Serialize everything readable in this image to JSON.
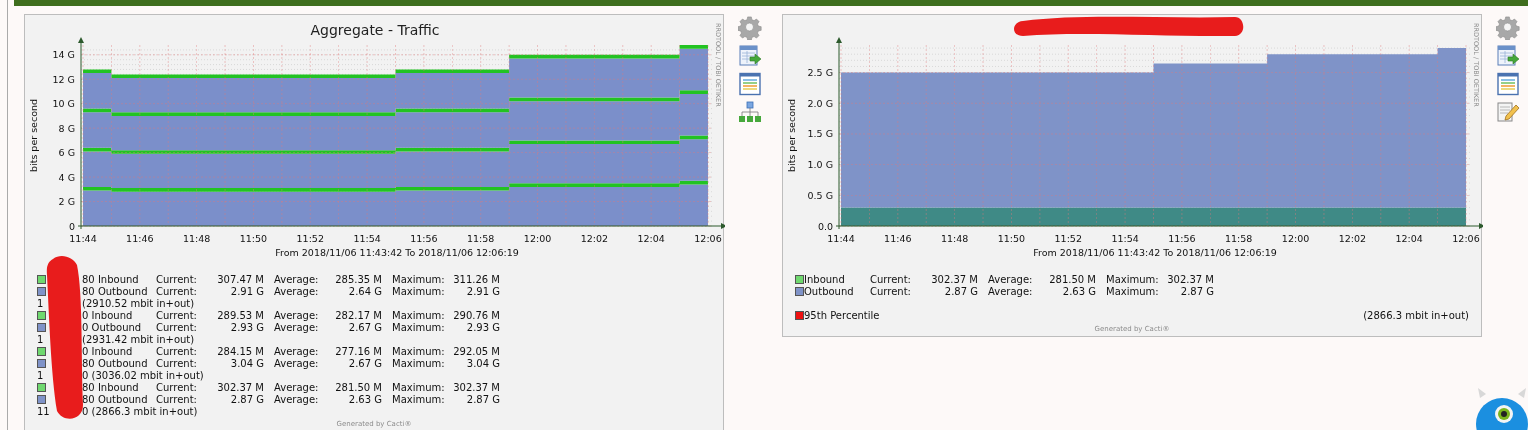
{
  "panels": [
    {
      "title": "Aggregate - Traffic",
      "title_redacted": false,
      "side_label": "RRDTOOL / TOBI OETIKER",
      "legend_redacted": true,
      "chart_data": {
        "type": "area",
        "stacked": true,
        "ylabel": "bits per second",
        "xlabel": "From 2018/11/06 11:43:42 To 2018/11/06 12:06:19",
        "grid": true,
        "categories": [
          "11:44",
          "11:46",
          "11:48",
          "11:50",
          "11:52",
          "11:54",
          "11:56",
          "11:58",
          "12:00",
          "12:02",
          "12:04",
          "12:06"
        ],
        "ylim": [
          0,
          14.8
        ],
        "yticks": [
          {
            "value": 0,
            "label": "0"
          },
          {
            "value": 2,
            "label": "2 G"
          },
          {
            "value": 4,
            "label": "4 G"
          },
          {
            "value": 6,
            "label": "6 G"
          },
          {
            "value": 8,
            "label": "8 G"
          },
          {
            "value": 10,
            "label": "10 G"
          },
          {
            "value": 12,
            "label": "12 G"
          },
          {
            "value": 14,
            "label": "14 G"
          }
        ],
        "series": [
          {
            "color": "#7b8fca",
            "values": [
              2.9,
              2.8,
              2.8,
              2.8,
              2.8,
              2.8,
              2.9,
              2.9,
              3.2,
              3.2,
              3.2,
              3.4
            ]
          },
          {
            "color": "#22c322",
            "values": [
              0.3,
              0.3,
              0.3,
              0.3,
              0.3,
              0.3,
              0.3,
              0.3,
              0.3,
              0.3,
              0.3,
              0.3
            ]
          },
          {
            "color": "#7b8fca",
            "values": [
              2.9,
              2.8,
              2.8,
              2.8,
              2.8,
              2.8,
              2.9,
              2.9,
              3.2,
              3.2,
              3.2,
              3.4
            ]
          },
          {
            "color": "#22c322",
            "values": [
              0.3,
              0.3,
              0.3,
              0.3,
              0.3,
              0.3,
              0.3,
              0.3,
              0.3,
              0.3,
              0.3,
              0.3
            ]
          },
          {
            "color": "#7b8fca",
            "values": [
              2.9,
              2.8,
              2.8,
              2.8,
              2.8,
              2.8,
              2.9,
              2.9,
              3.2,
              3.2,
              3.2,
              3.4
            ]
          },
          {
            "color": "#22c322",
            "values": [
              0.3,
              0.3,
              0.3,
              0.3,
              0.3,
              0.3,
              0.3,
              0.3,
              0.3,
              0.3,
              0.3,
              0.3
            ]
          },
          {
            "color": "#7b8fca",
            "values": [
              2.9,
              2.8,
              2.8,
              2.8,
              2.8,
              2.8,
              2.9,
              2.9,
              3.2,
              3.2,
              3.2,
              3.4
            ]
          },
          {
            "color": "#22c322",
            "values": [
              0.3,
              0.3,
              0.3,
              0.3,
              0.3,
              0.3,
              0.3,
              0.3,
              0.3,
              0.3,
              0.3,
              0.3
            ]
          }
        ]
      },
      "legend": [
        {
          "kind": "series",
          "color": "#6fd86f",
          "label": "80 Inbound",
          "stats": [
            {
              "label": "Current:",
              "value": "307.47 M"
            },
            {
              "label": "Average:",
              "value": "285.35 M"
            },
            {
              "label": "Maximum:",
              "value": "311.26 M"
            }
          ]
        },
        {
          "kind": "series",
          "color": "#7f93c8",
          "label": "80 Outbound",
          "stats": [
            {
              "label": "Current:",
              "value": "2.91 G"
            },
            {
              "label": "Average:",
              "value": "2.64 G"
            },
            {
              "label": "Maximum:",
              "value": "2.91 G"
            }
          ]
        },
        {
          "kind": "total",
          "prefix": "1",
          "text": "(2910.52 mbit in+out)"
        },
        {
          "kind": "series",
          "color": "#6fd86f",
          "label": "0 Inbound",
          "stats": [
            {
              "label": "Current:",
              "value": "289.53 M"
            },
            {
              "label": "Average:",
              "value": "282.17 M"
            },
            {
              "label": "Maximum:",
              "value": "290.76 M"
            }
          ]
        },
        {
          "kind": "series",
          "color": "#7f93c8",
          "label": "0 Outbound",
          "stats": [
            {
              "label": "Current:",
              "value": "2.93 G"
            },
            {
              "label": "Average:",
              "value": "2.67 G"
            },
            {
              "label": "Maximum:",
              "value": "2.93 G"
            }
          ]
        },
        {
          "kind": "total",
          "prefix": "1",
          "text": "(2931.42 mbit in+out)"
        },
        {
          "kind": "series",
          "color": "#6fd86f",
          "label": "0 Inbound",
          "stats": [
            {
              "label": "Current:",
              "value": "284.15 M"
            },
            {
              "label": "Average:",
              "value": "277.16 M"
            },
            {
              "label": "Maximum:",
              "value": "292.05 M"
            }
          ]
        },
        {
          "kind": "series",
          "color": "#7f93c8",
          "label": "80 Outbound",
          "stats": [
            {
              "label": "Current:",
              "value": "3.04 G"
            },
            {
              "label": "Average:",
              "value": "2.67 G"
            },
            {
              "label": "Maximum:",
              "value": "3.04 G"
            }
          ]
        },
        {
          "kind": "total",
          "prefix": "1",
          "text": "0 (3036.02 mbit in+out)"
        },
        {
          "kind": "series",
          "color": "#6fd86f",
          "label": "80 Inbound",
          "stats": [
            {
              "label": "Current:",
              "value": "302.37 M"
            },
            {
              "label": "Average:",
              "value": "281.50 M"
            },
            {
              "label": "Maximum:",
              "value": "302.37 M"
            }
          ]
        },
        {
          "kind": "series",
          "color": "#7f93c8",
          "label": "80 Outbound",
          "stats": [
            {
              "label": "Current:",
              "value": "2.87 G"
            },
            {
              "label": "Average:",
              "value": "2.63 G"
            },
            {
              "label": "Maximum:",
              "value": "2.87 G"
            }
          ]
        },
        {
          "kind": "total",
          "prefix": "11",
          "text": "0 (2866.3 mbit in+out)"
        }
      ],
      "footer": "Generated by Cacti®",
      "icons": [
        {
          "kind": "settings"
        },
        {
          "kind": "export"
        },
        {
          "kind": "legend"
        },
        {
          "kind": "tree"
        }
      ]
    },
    {
      "title_redacted": true,
      "side_label": "RRDTOOL / TOBI OETIKER",
      "legend_redacted": false,
      "chart_data": {
        "type": "area",
        "stacked": true,
        "ylabel": "bits per second",
        "xlabel": "From 2018/11/06 11:43:42 To 2018/11/06 12:06:19",
        "grid": true,
        "categories": [
          "11:44",
          "11:46",
          "11:48",
          "11:50",
          "11:52",
          "11:54",
          "11:56",
          "11:58",
          "12:00",
          "12:02",
          "12:04",
          "12:06"
        ],
        "ylim": [
          0,
          2.95
        ],
        "yticks": [
          {
            "value": 0,
            "label": "0.0"
          },
          {
            "value": 0.5,
            "label": "0.5 G"
          },
          {
            "value": 1,
            "label": "1.0 G"
          },
          {
            "value": 1.5,
            "label": "1.5 G"
          },
          {
            "value": 2,
            "label": "2.0 G"
          },
          {
            "value": 2.5,
            "label": "2.5 G"
          }
        ],
        "series": [
          {
            "color": "#3f8a86",
            "values": [
              0.3,
              0.3,
              0.3,
              0.3,
              0.3,
              0.3,
              0.3,
              0.3,
              0.3,
              0.3,
              0.3,
              0.3
            ]
          },
          {
            "color": "#7f93c8",
            "values": [
              2.2,
              2.2,
              2.2,
              2.2,
              2.2,
              2.2,
              2.35,
              2.35,
              2.5,
              2.5,
              2.5,
              2.6
            ]
          }
        ]
      },
      "legend": [
        {
          "kind": "series",
          "color": "#6fd86f",
          "label": "Inbound",
          "stats": [
            {
              "label": "Current:",
              "value": "302.37 M"
            },
            {
              "label": "Average:",
              "value": "281.50 M"
            },
            {
              "label": "Maximum:",
              "value": "302.37 M"
            }
          ]
        },
        {
          "kind": "series",
          "color": "#7f93c8",
          "label": "Outbound",
          "stats": [
            {
              "label": "Current:",
              "value": "2.87 G"
            },
            {
              "label": "Average:",
              "value": "2.63 G"
            },
            {
              "label": "Maximum:",
              "value": "2.87 G"
            }
          ]
        },
        {
          "kind": "percentile",
          "color": "#ee1111",
          "label": "95th Percentile",
          "text": "(2866.3 mbit in+out)"
        }
      ],
      "footer": "Generated by Cacti®",
      "icons": [
        {
          "kind": "settings"
        },
        {
          "kind": "export"
        },
        {
          "kind": "legend"
        },
        {
          "kind": "edit"
        }
      ]
    }
  ]
}
